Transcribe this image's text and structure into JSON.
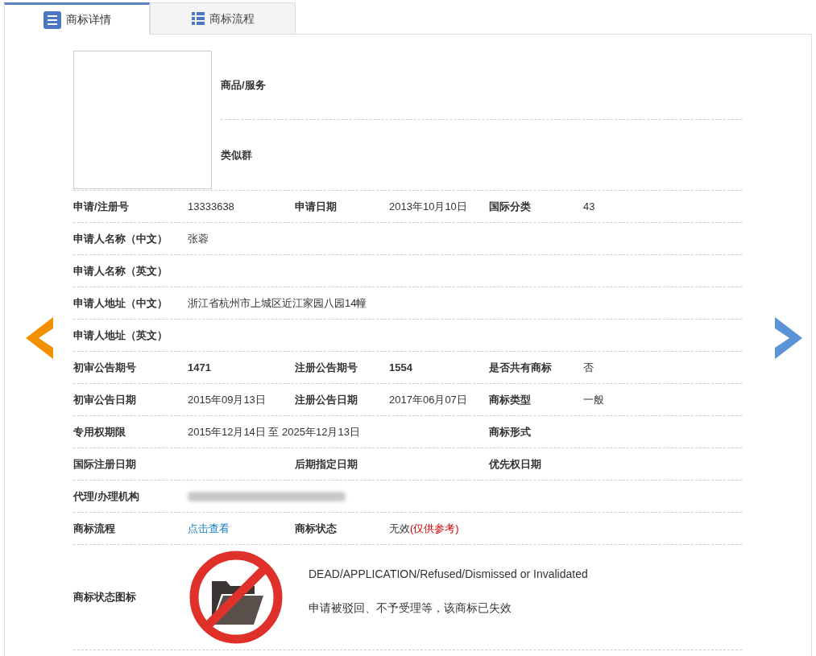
{
  "tabs": [
    {
      "label": "商标详情",
      "selected": true
    },
    {
      "label": "商标流程",
      "selected": false
    }
  ],
  "top": {
    "goods_label": "商品/服务",
    "group_label": "类似群"
  },
  "rows": [
    {
      "left": {
        "label": "申请/注册号",
        "value": "13333638"
      },
      "middle": {
        "label": "申请日期",
        "value": "2013年10月10日"
      },
      "right": {
        "label": "国际分类",
        "value": "43"
      }
    },
    {
      "left": {
        "label": "申请人名称（中文）",
        "value": "张蓉"
      }
    },
    {
      "left": {
        "label": "申请人名称（英文）"
      }
    },
    {
      "left": {
        "label": "申请人地址（中文）",
        "value": "浙江省杭州市上城区近江家园八园14幢"
      }
    },
    {
      "left": {
        "label": "申请人地址（英文）"
      }
    },
    {
      "left": {
        "label": "初审公告期号",
        "value": "1471",
        "kind": "bold"
      },
      "middle": {
        "label": "注册公告期号",
        "value": "1554",
        "kind": "bold"
      },
      "right": {
        "label": "是否共有商标",
        "value": "否"
      }
    },
    {
      "left": {
        "label": "初审公告日期",
        "value": "2015年09月13日"
      },
      "middle": {
        "label": "注册公告日期",
        "value": "2017年06月07日"
      },
      "right": {
        "label": "商标类型",
        "value": "一般"
      }
    },
    {
      "left": {
        "label": "专用权期限",
        "value": "2015年12月14日 至 2025年12月13日"
      },
      "right": {
        "label": "商标形式"
      }
    },
    {
      "left": {
        "label": "国际注册日期"
      },
      "middle": {
        "label": "后期指定日期"
      },
      "right": {
        "label": "优先权日期"
      }
    },
    {
      "left": {
        "label": "代理/办理机构",
        "kind": "redacted"
      }
    },
    {
      "left": {
        "label": "商标流程",
        "value": "点击查看",
        "kind": "link"
      },
      "middle": {
        "label": "商标状态",
        "value": "无效",
        "note": "(仅供参考)",
        "kind": "status"
      }
    }
  ],
  "status_icon": {
    "label": "商标状态图标",
    "english": "DEAD/APPLICATION/Refused/Dismissed or Invalidated",
    "chinese": "申请被驳回、不予受理等，该商标已失效"
  }
}
